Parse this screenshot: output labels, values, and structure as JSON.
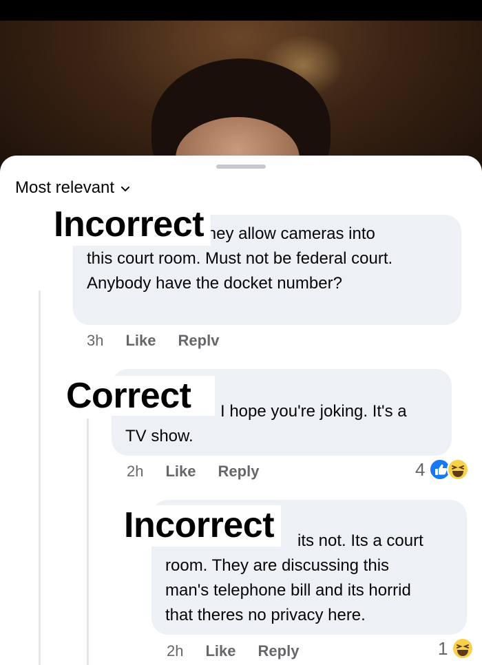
{
  "sort": {
    "label": "Most relevant"
  },
  "comments": [
    {
      "overlay_label": "Incorrect",
      "lines": [
        "Hard to believe they allow cameras into",
        "this court room. Must not be federal court.",
        "Anybody have the docket number?"
      ],
      "time": "3h",
      "like_label": "Like",
      "reply_label": "Replv"
    },
    {
      "overlay_label": "Correct",
      "lines": [
        "I hope you're joking. It's a",
        "TV show."
      ],
      "time": "2h",
      "like_label": "Like",
      "reply_label": "Reply",
      "reaction_count": "4",
      "reactions": [
        "like-icon",
        "haha-icon"
      ]
    },
    {
      "overlay_label": "Incorrect",
      "lines": [
        "its not. Its a court",
        "room. They are discussing this",
        "man's telephone bill and its horrid",
        "that theres no privacy here."
      ],
      "time": "2h",
      "like_label": "Like",
      "reply_label": "Reply",
      "reaction_count": "1",
      "reactions": [
        "haha-icon"
      ]
    }
  ],
  "colors": {
    "bubble": "#edf1f5",
    "meta": "#65676b",
    "like_blue": "#1877f2",
    "haha_yellow": "#f7d14c"
  }
}
